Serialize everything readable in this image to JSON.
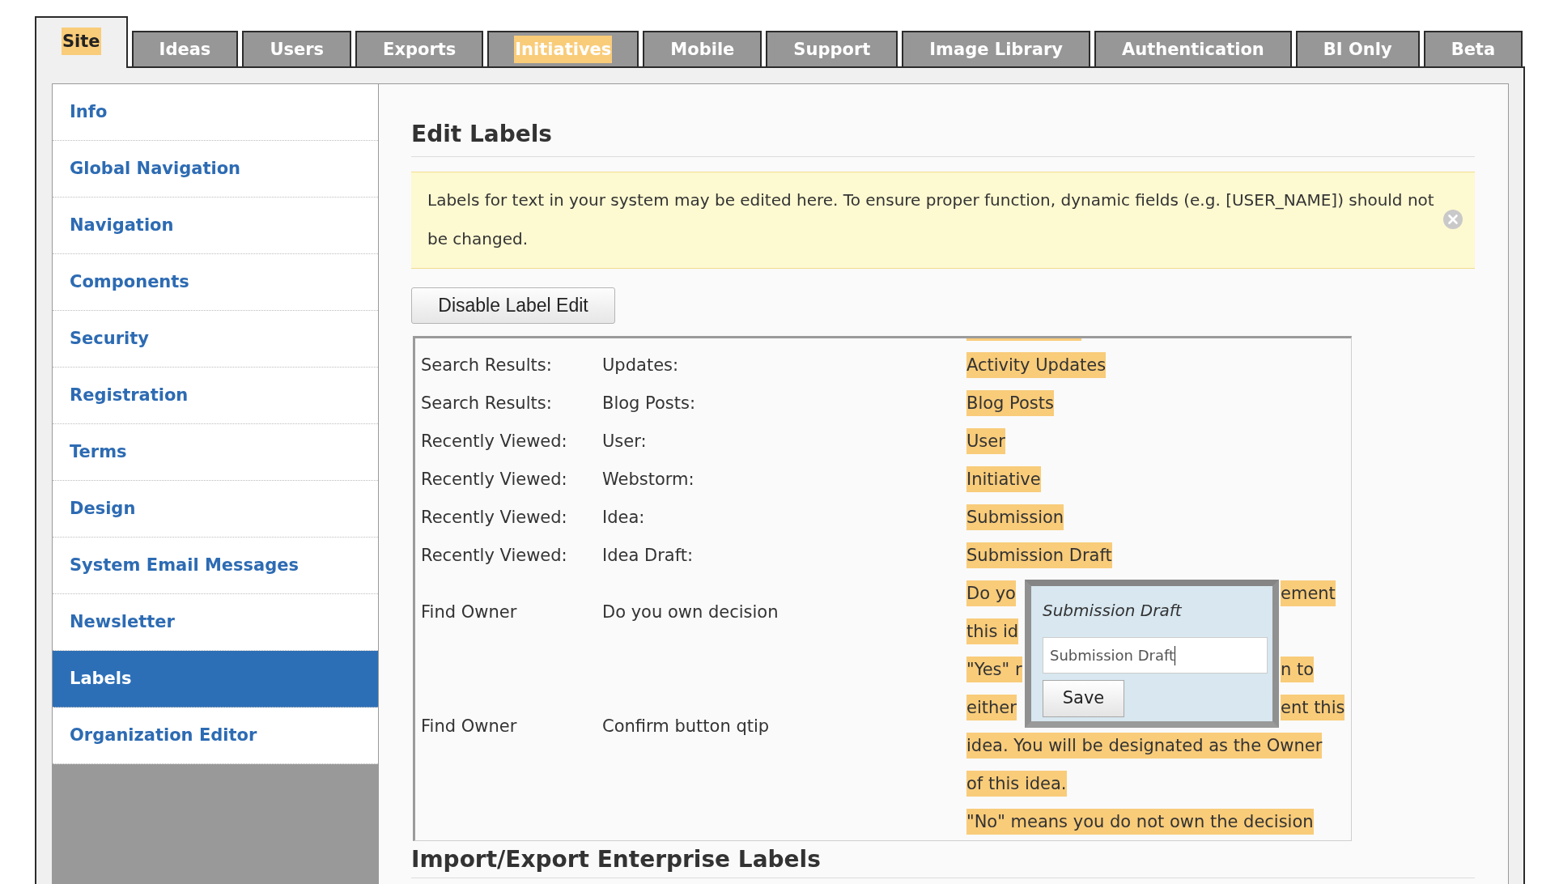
{
  "tabs": [
    {
      "label": "Site",
      "selected": true,
      "highlighted": true
    },
    {
      "label": "Ideas",
      "selected": false,
      "highlighted": false
    },
    {
      "label": "Users",
      "selected": false,
      "highlighted": false
    },
    {
      "label": "Exports",
      "selected": false,
      "highlighted": false
    },
    {
      "label": "Initiatives",
      "selected": false,
      "highlighted": true
    },
    {
      "label": "Mobile",
      "selected": false,
      "highlighted": false
    },
    {
      "label": "Support",
      "selected": false,
      "highlighted": false
    },
    {
      "label": "Image Library",
      "selected": false,
      "highlighted": false
    },
    {
      "label": "Authentication",
      "selected": false,
      "highlighted": false
    },
    {
      "label": "BI Only",
      "selected": false,
      "highlighted": false
    },
    {
      "label": "Beta",
      "selected": false,
      "highlighted": false
    }
  ],
  "sidebar": {
    "items": [
      {
        "label": "Info",
        "selected": false
      },
      {
        "label": "Global Navigation",
        "selected": false
      },
      {
        "label": "Navigation",
        "selected": false
      },
      {
        "label": "Components",
        "selected": false
      },
      {
        "label": "Security",
        "selected": false
      },
      {
        "label": "Registration",
        "selected": false
      },
      {
        "label": "Terms",
        "selected": false
      },
      {
        "label": "Design",
        "selected": false
      },
      {
        "label": "System Email Messages",
        "selected": false
      },
      {
        "label": "Newsletter",
        "selected": false
      },
      {
        "label": "Labels",
        "selected": true
      },
      {
        "label": "Organization Editor",
        "selected": false
      }
    ]
  },
  "main": {
    "title": "Edit Labels",
    "notice": {
      "text": "Labels for text in your system may be edited here. To ensure proper function, dynamic fields (e.g. [USER_NAME]) should not be changed."
    },
    "toggle_button": "Disable Label Edit",
    "labels_table": {
      "rows": [
        {
          "section": "Search Results:",
          "key": "Updates:",
          "value_lines": [
            {
              "kind": "text",
              "text": "Activity Updates"
            }
          ]
        },
        {
          "section": "Search Results:",
          "key": "Blog Posts:",
          "value_lines": [
            {
              "kind": "text",
              "text": "Blog Posts"
            }
          ]
        },
        {
          "section": "Recently Viewed:",
          "key": "User:",
          "value_lines": [
            {
              "kind": "text",
              "text": "User"
            }
          ]
        },
        {
          "section": "Recently Viewed:",
          "key": "Webstorm:",
          "value_lines": [
            {
              "kind": "text",
              "text": "Initiative"
            }
          ]
        },
        {
          "section": "Recently Viewed:",
          "key": "Idea:",
          "value_lines": [
            {
              "kind": "text",
              "text": "Submission"
            }
          ]
        },
        {
          "section": "Recently Viewed:",
          "key": "Idea Draft:",
          "value_lines": [
            {
              "kind": "text",
              "text": "Submission Draft"
            }
          ]
        },
        {
          "section": "Find Owner",
          "key": "Do you own decision",
          "value_lines": [
            {
              "kind": "split",
              "left": "Do yo",
              "right": "ement"
            },
            {
              "kind": "split",
              "left": "this id"
            }
          ]
        },
        {
          "section": "Find Owner",
          "key": "Confirm button qtip",
          "value_lines": [
            {
              "kind": "split",
              "left": "\"Yes\" r",
              "right": "n to"
            },
            {
              "kind": "split",
              "left": "either",
              "right": "ent this"
            },
            {
              "kind": "text",
              "text": "idea. You will be designated as the Owner"
            },
            {
              "kind": "text",
              "text": "of this idea."
            }
          ]
        },
        {
          "value_lines": [
            {
              "kind": "text",
              "text": "\"No\" means you do not own the decision"
            }
          ]
        }
      ]
    },
    "editor_popup": {
      "title": "Submission Draft",
      "value": "Submission Draft",
      "save_button": "Save"
    },
    "section_title": "Import/Export Enterprise Labels"
  }
}
